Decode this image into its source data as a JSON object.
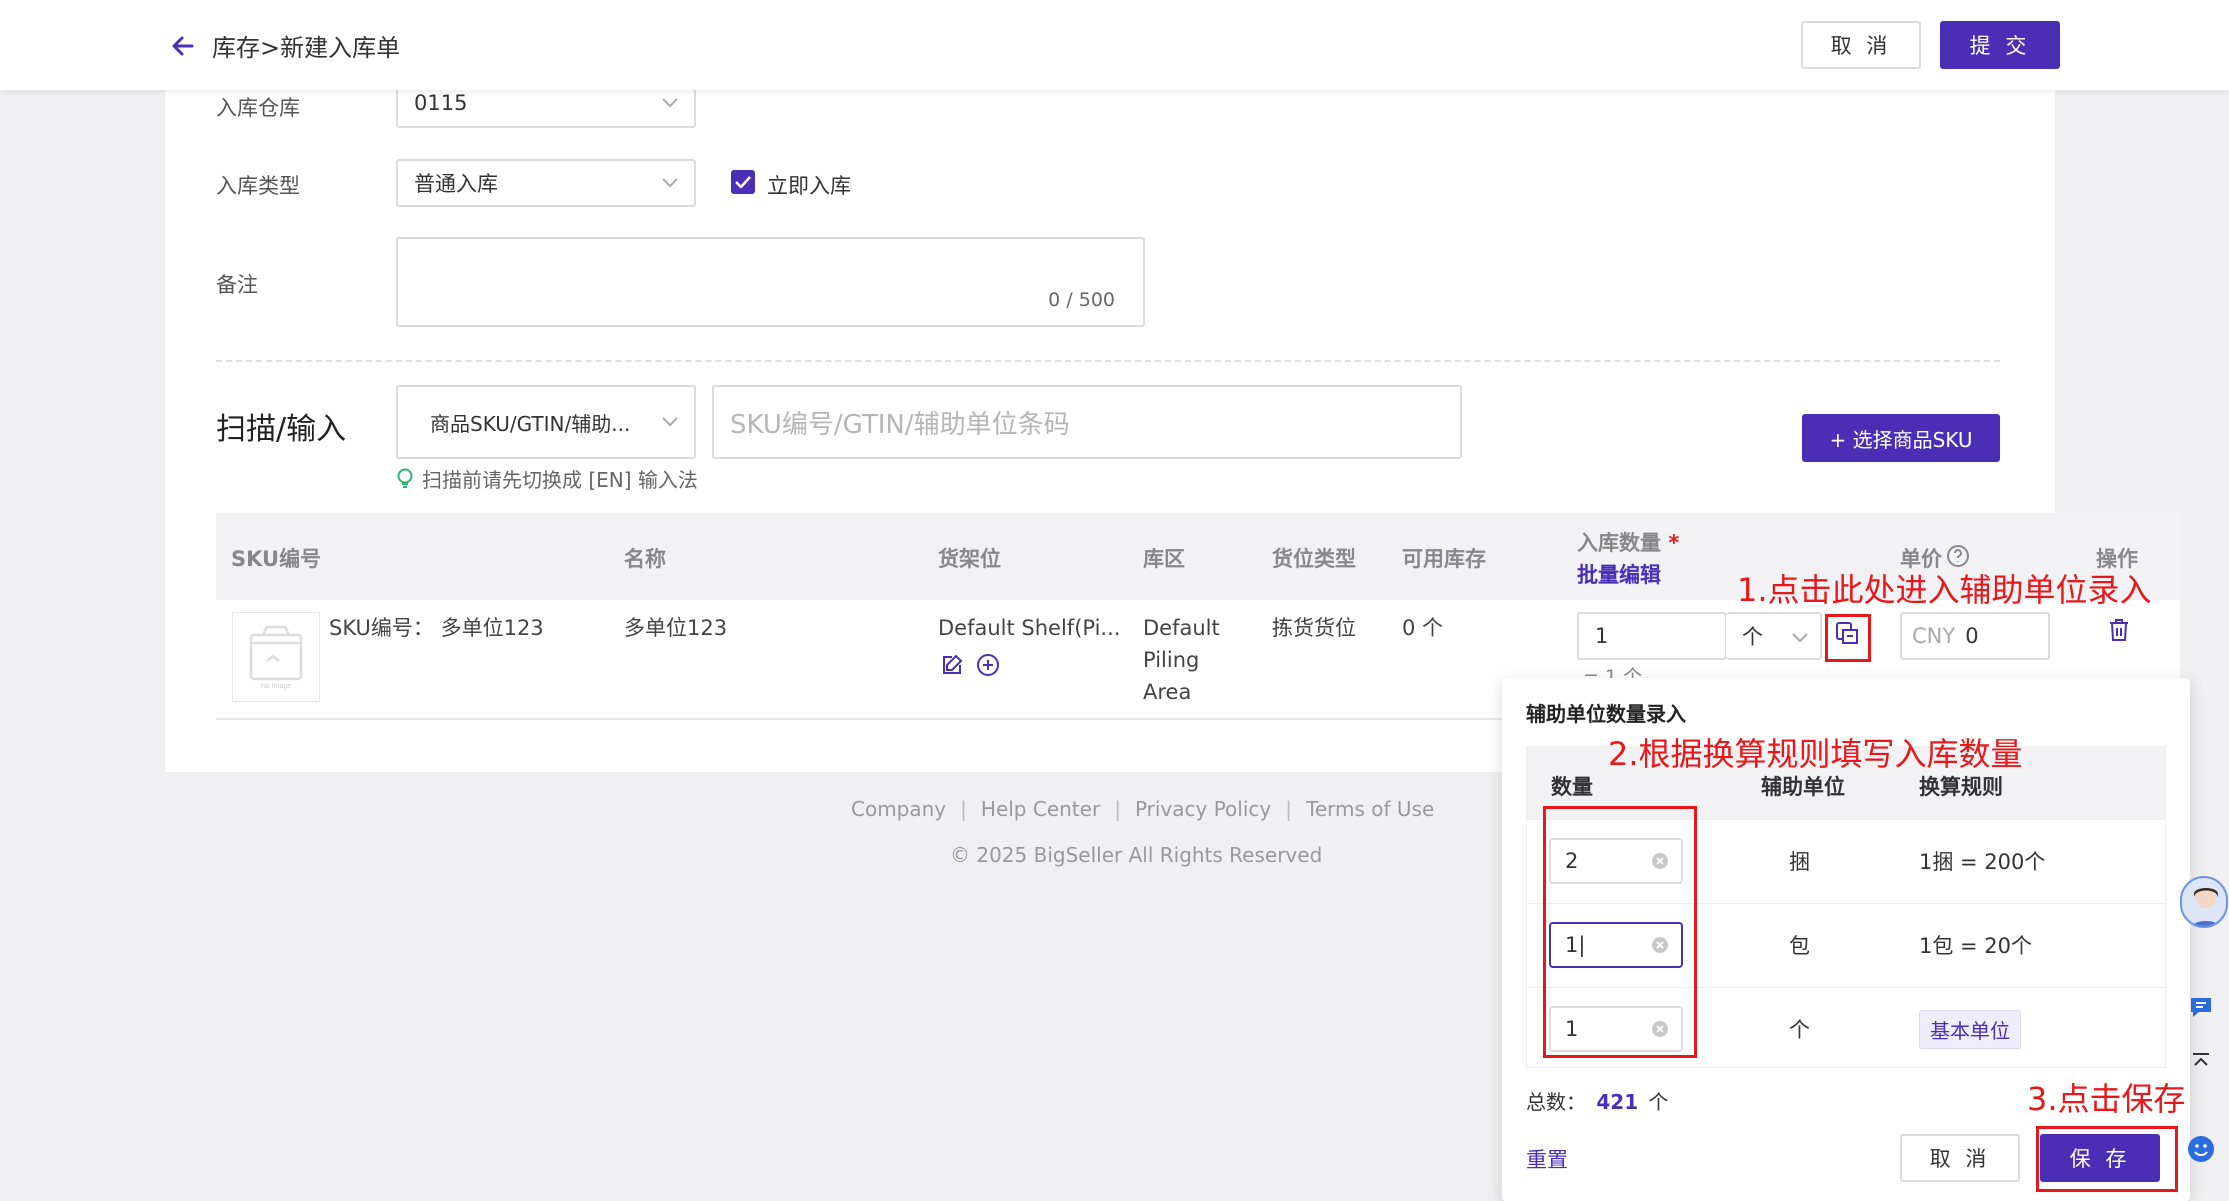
{
  "header": {
    "title": "库存>新建入库单",
    "cancel_label": "取 消",
    "submit_label": "提 交"
  },
  "form": {
    "warehouse_label": "入库仓库",
    "warehouse_value": "0115",
    "type_label": "入库类型",
    "type_value": "普通入库",
    "immediate_label": "立即入库",
    "remark_label": "备注",
    "remark_counter": "0 / 500"
  },
  "scan": {
    "title": "扫描/输入",
    "mode_value": "商品SKU/GTIN/辅助...",
    "placeholder": "SKU编号/GTIN/辅助单位条码",
    "hint": "扫描前请先切换成 [EN] 输入法",
    "select_sku_label": "+ 选择商品SKU"
  },
  "table": {
    "headers": {
      "sku": "SKU编号",
      "name": "名称",
      "shelf": "货架位",
      "zone": "库区",
      "slot_type": "货位类型",
      "available": "可用库存",
      "qty": "入库数量",
      "qty_required": "*",
      "batch_edit": "批量编辑",
      "price": "单价",
      "action": "操作"
    },
    "row": {
      "img_text": "No Image",
      "sku": "SKU编号： 多单位123",
      "name": "多单位123",
      "shelf": "Default Shelf(Pi...",
      "zone_line1": "Default",
      "zone_line2": "Piling",
      "zone_line3": "Area",
      "slot_type": "拣货货位",
      "available": "0 个",
      "qty_value": "1",
      "unit_value": "个",
      "qty_sub": "= 1 个",
      "currency": "CNY",
      "price_value": "0"
    }
  },
  "footer": {
    "links": [
      "Company",
      "Help Center",
      "Privacy Policy",
      "Terms of Use"
    ],
    "copyright": "© 2025 BigSeller All Rights Reserved"
  },
  "popup": {
    "title": "辅助单位数量录入",
    "headers": {
      "qty": "数量",
      "unit": "辅助单位",
      "rule": "换算规则"
    },
    "rows": [
      {
        "qty": "2",
        "unit": "捆",
        "rule": "1捆 = 200个"
      },
      {
        "qty": "1",
        "unit": "包",
        "rule": "1包 = 20个"
      },
      {
        "qty": "1",
        "unit": "个",
        "rule": "基本单位"
      }
    ],
    "total_label": "总数：",
    "total_value": "421",
    "total_unit": "个",
    "reset_label": "重置",
    "cancel_label": "取 消",
    "save_label": "保 存"
  },
  "annotations": {
    "step1": "1.点击此处进入辅助单位录入",
    "step2": "2.根据换算规则填写入库数量",
    "step3": "3.点击保存"
  },
  "colors": {
    "primary": "#4a2fb6",
    "annotation": "#e8171a"
  }
}
